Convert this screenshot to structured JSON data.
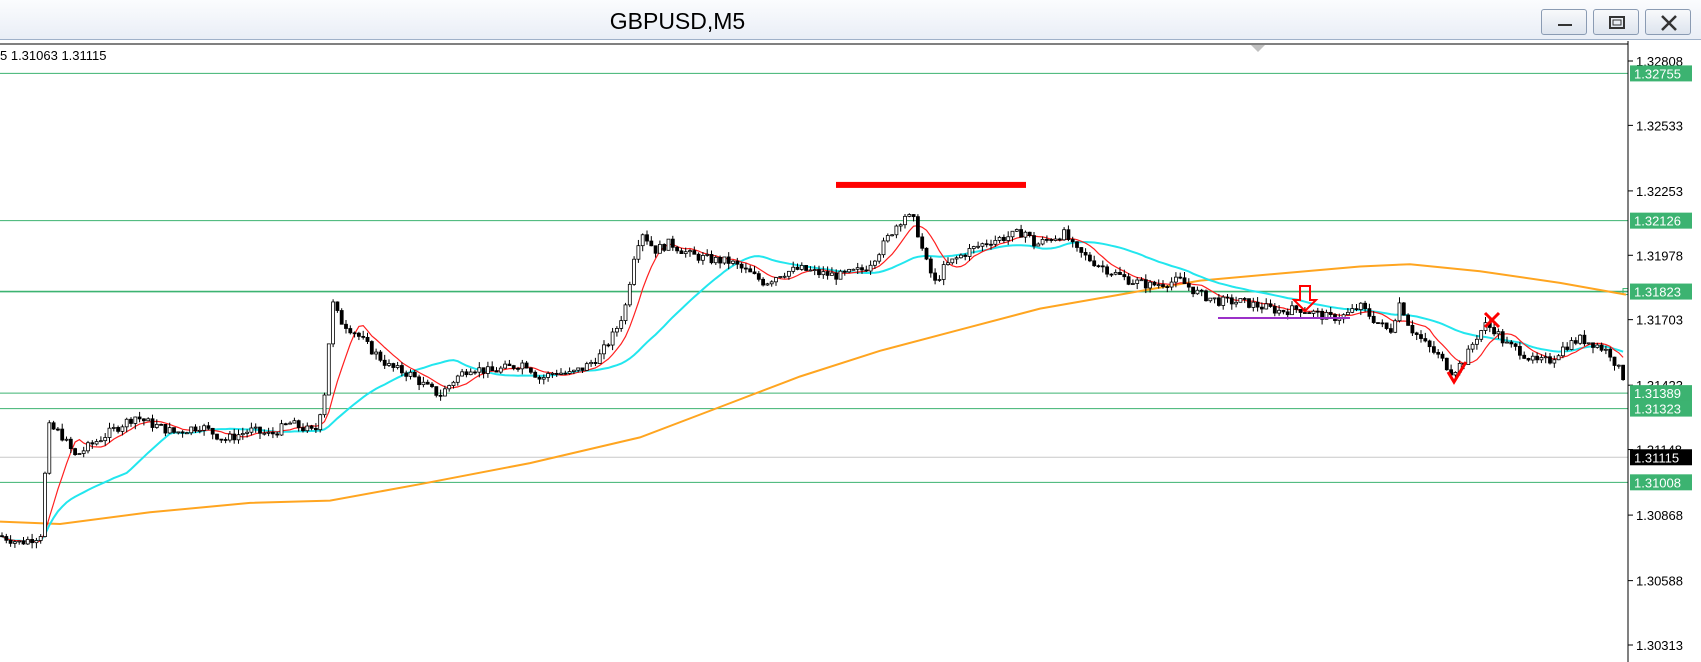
{
  "window": {
    "title": "GBPUSD,M5",
    "buttons": [
      "minimize",
      "maximize",
      "close"
    ]
  },
  "chart": {
    "ohlc_text": "5 1.31063 1.31115",
    "symbol": "GBPUSD",
    "timeframe": "M5",
    "price_axis": {
      "labels": [
        {
          "text": "1.32808",
          "value": 1.32808
        },
        {
          "text": "1.32533",
          "value": 1.32533
        },
        {
          "text": "1.32253",
          "value": 1.32253
        },
        {
          "text": "1.31978",
          "value": 1.31978
        },
        {
          "text": "1.31703",
          "value": 1.31703
        },
        {
          "text": "1.31423",
          "value": 1.31423
        },
        {
          "text": "1.31148",
          "value": 1.31148
        },
        {
          "text": "1.30868",
          "value": 1.30868
        },
        {
          "text": "1.30588",
          "value": 1.30588
        },
        {
          "text": "1.30313",
          "value": 1.30313
        }
      ]
    },
    "horizontal_levels": [
      {
        "text": "1.32755",
        "value": 1.32755,
        "color": "#3cb371"
      },
      {
        "text": "1.32126",
        "value": 1.32126,
        "color": "#3cb371"
      },
      {
        "text": "1.31823",
        "value": 1.31823,
        "color": "#3cb371"
      },
      {
        "text": "1.31389",
        "value": 1.31389,
        "color": "#3cb371"
      },
      {
        "text": "1.31323",
        "value": 1.31323,
        "color": "#3cb371"
      },
      {
        "text": "1.31008",
        "value": 1.31008,
        "color": "#3cb371"
      }
    ],
    "current_price": {
      "text": "1.31115",
      "value": 1.31115,
      "color": "#000000"
    },
    "colors": {
      "candles": "#000000",
      "ma_fast": "#ff2020",
      "ma_mid": "#22e6ee",
      "ma_slow": "#ffa520",
      "level": "#3cb371",
      "marker": "#ff0000",
      "purple_line": "#9b30c8"
    }
  }
}
